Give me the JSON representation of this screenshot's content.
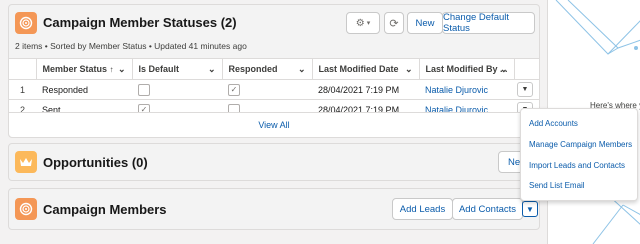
{
  "campaign_member_statuses": {
    "title": "Campaign Member Statuses (2)",
    "subtitle": "2 items • Sorted by Member Status • Updated 41 minutes ago",
    "buttons": {
      "settings_icon": "gear-icon",
      "refresh_icon": "refresh-icon",
      "new": "New",
      "change_default": "Change Default Status"
    },
    "columns": [
      "Member Status",
      "Is Default",
      "Responded",
      "Last Modified Date",
      "Last Modified By ..."
    ],
    "rows": [
      {
        "num": "1",
        "status": "Responded",
        "is_default": false,
        "responded": true,
        "modified_date": "28/04/2021 7:19 PM",
        "modified_by": "Natalie Djurovic"
      },
      {
        "num": "2",
        "status": "Sent",
        "is_default": true,
        "responded": false,
        "modified_date": "28/04/2021 7:19 PM",
        "modified_by": "Natalie Djurovic"
      }
    ],
    "view_all": "View All"
  },
  "opportunities": {
    "title": "Opportunities (0)",
    "new_label": "New"
  },
  "campaign_members": {
    "title": "Campaign Members",
    "add_leads": "Add Leads",
    "add_contacts": "Add Contacts"
  },
  "dropdown": {
    "items": [
      "Add Accounts",
      "Manage Campaign Members",
      "Import Leads and Contacts",
      "Send List Email"
    ]
  },
  "right_panel": {
    "text": "Here's where y"
  },
  "colors": {
    "campaign_icon": "#f49756",
    "opportunity_icon": "#fcb95b",
    "link": "#0b5cab"
  }
}
